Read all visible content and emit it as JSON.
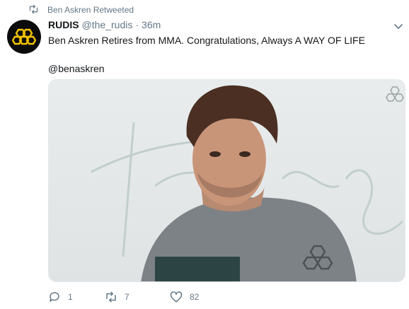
{
  "retweet_context": {
    "label": "Ben Askren Retweeted",
    "icon": "retweet-icon"
  },
  "author": {
    "name": "RUDIS",
    "handle": "@the_rudis",
    "separator": "·",
    "time": "36m",
    "avatar_icon": "honeycomb-logo-icon",
    "brand_color": "#f2c200"
  },
  "tweet": {
    "text": "Ben Askren Retires from MMA. Congratulations, Always A WAY OF LIFE",
    "mention": "@benaskren"
  },
  "media": {
    "kind": "photo",
    "alt": "Ben Askren portrait"
  },
  "actions": {
    "reply": {
      "icon": "reply-icon",
      "count": "1"
    },
    "retweet": {
      "icon": "retweet-icon",
      "count": "7"
    },
    "like": {
      "icon": "heart-icon",
      "count": "82"
    }
  },
  "colors": {
    "secondary_text": "#657786",
    "primary_text": "#14171a"
  }
}
